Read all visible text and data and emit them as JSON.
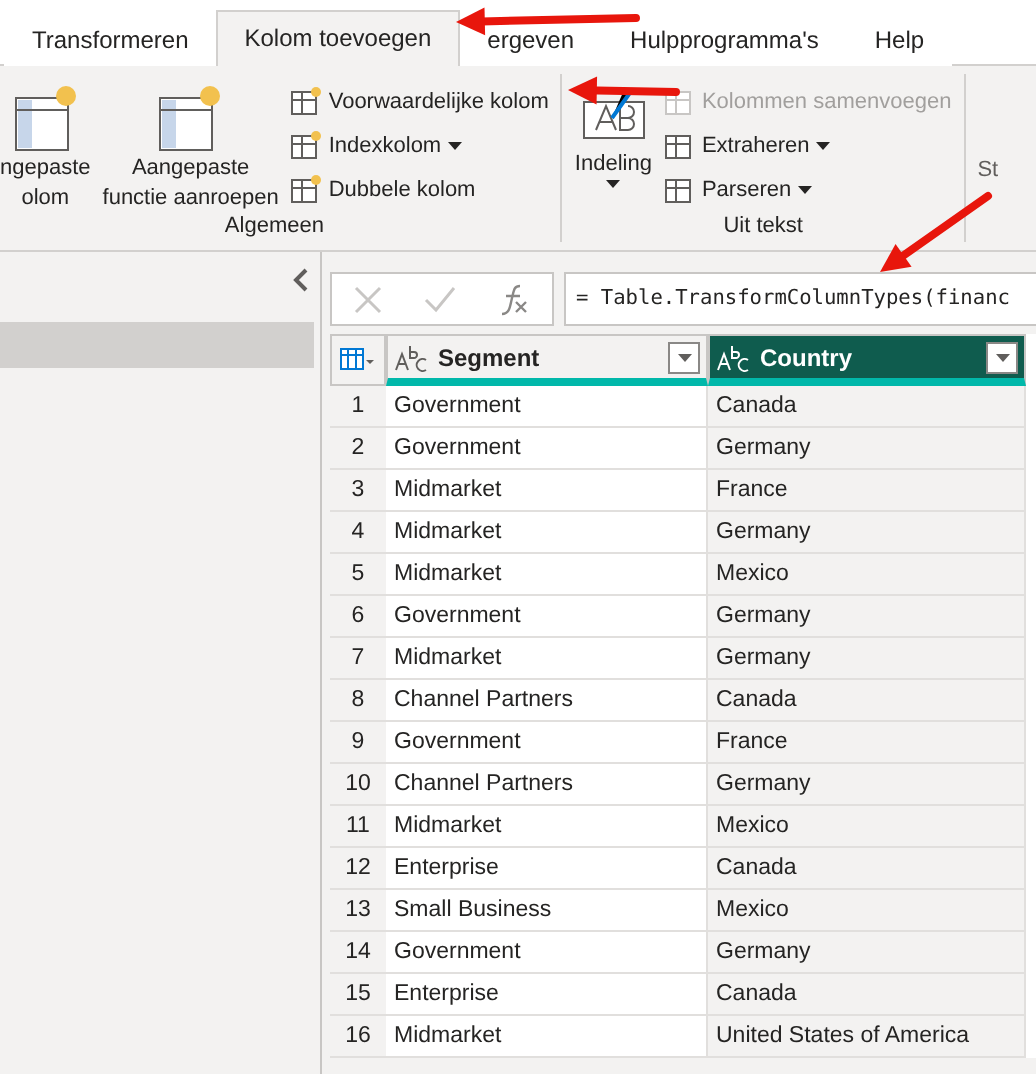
{
  "tabs": [
    {
      "label": "Transformeren",
      "selected": false
    },
    {
      "label": "Kolom toevoegen",
      "selected": true
    },
    {
      "label": "ergeven",
      "selected": false
    },
    {
      "label": "Hulpprogramma's",
      "selected": false
    },
    {
      "label": "Help",
      "selected": false
    }
  ],
  "ribbon": {
    "groups": [
      {
        "label": "Algemeen",
        "large_buttons": [
          {
            "lines": [
              "ngepaste",
              "olom"
            ],
            "dropdown": false
          },
          {
            "lines": [
              "Aangepaste",
              "functie aanroepen"
            ],
            "dropdown": false
          }
        ],
        "small_buttons": [
          {
            "label": "Voorwaardelijke kolom",
            "dropdown": false,
            "disabled": false
          },
          {
            "label": "Indexkolom",
            "dropdown": true,
            "disabled": false
          },
          {
            "label": "Dubbele kolom",
            "dropdown": false,
            "disabled": false
          }
        ]
      },
      {
        "label": "Uit tekst",
        "large_buttons": [
          {
            "lines": [
              "Indeling"
            ],
            "dropdown": true
          }
        ],
        "small_buttons": [
          {
            "label": "Kolommen samenvoegen",
            "dropdown": false,
            "disabled": true
          },
          {
            "label": "Extraheren",
            "dropdown": true,
            "disabled": false
          },
          {
            "label": "Parseren",
            "dropdown": true,
            "disabled": false
          }
        ]
      }
    ],
    "next_group_label": "St"
  },
  "formula": "= Table.TransformColumnTypes(financ",
  "table": {
    "columns": [
      {
        "label": "Segment",
        "selected": false
      },
      {
        "label": "Country",
        "selected": true
      }
    ],
    "rows": [
      {
        "number": "1",
        "cells": [
          "Government",
          "Canada"
        ]
      },
      {
        "number": "2",
        "cells": [
          "Government",
          "Germany"
        ]
      },
      {
        "number": "3",
        "cells": [
          "Midmarket",
          "France"
        ]
      },
      {
        "number": "4",
        "cells": [
          "Midmarket",
          "Germany"
        ]
      },
      {
        "number": "5",
        "cells": [
          "Midmarket",
          "Mexico"
        ]
      },
      {
        "number": "6",
        "cells": [
          "Government",
          "Germany"
        ]
      },
      {
        "number": "7",
        "cells": [
          "Midmarket",
          "Germany"
        ]
      },
      {
        "number": "8",
        "cells": [
          "Channel Partners",
          "Canada"
        ]
      },
      {
        "number": "9",
        "cells": [
          "Government",
          "France"
        ]
      },
      {
        "number": "10",
        "cells": [
          "Channel Partners",
          "Germany"
        ]
      },
      {
        "number": "11",
        "cells": [
          "Midmarket",
          "Mexico"
        ]
      },
      {
        "number": "12",
        "cells": [
          "Enterprise",
          "Canada"
        ]
      },
      {
        "number": "13",
        "cells": [
          "Small Business",
          "Mexico"
        ]
      },
      {
        "number": "14",
        "cells": [
          "Government",
          "Germany"
        ]
      },
      {
        "number": "15",
        "cells": [
          "Enterprise",
          "Canada"
        ]
      },
      {
        "number": "16",
        "cells": [
          "Midmarket",
          "United States of America"
        ]
      }
    ]
  }
}
